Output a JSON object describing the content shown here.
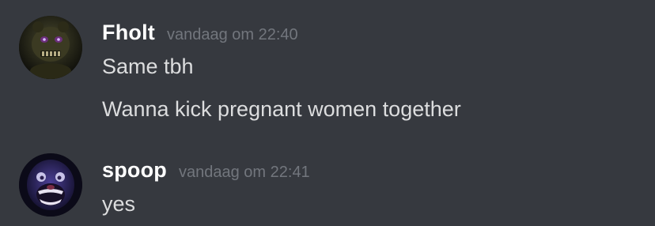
{
  "messages": [
    {
      "username": "Fholt",
      "timestamp": "vandaag om 22:40",
      "avatar": "freddy-shadow-avatar",
      "lines": [
        "Same tbh",
        "Wanna kick pregnant women together"
      ]
    },
    {
      "username": "spoop",
      "timestamp": "vandaag om 22:41",
      "avatar": "bonnie-avatar",
      "lines": [
        "yes"
      ]
    }
  ],
  "colors": {
    "background": "#36393f",
    "username": "#ffffff",
    "timestamp": "#72767d",
    "message_text": "#dcddde"
  }
}
